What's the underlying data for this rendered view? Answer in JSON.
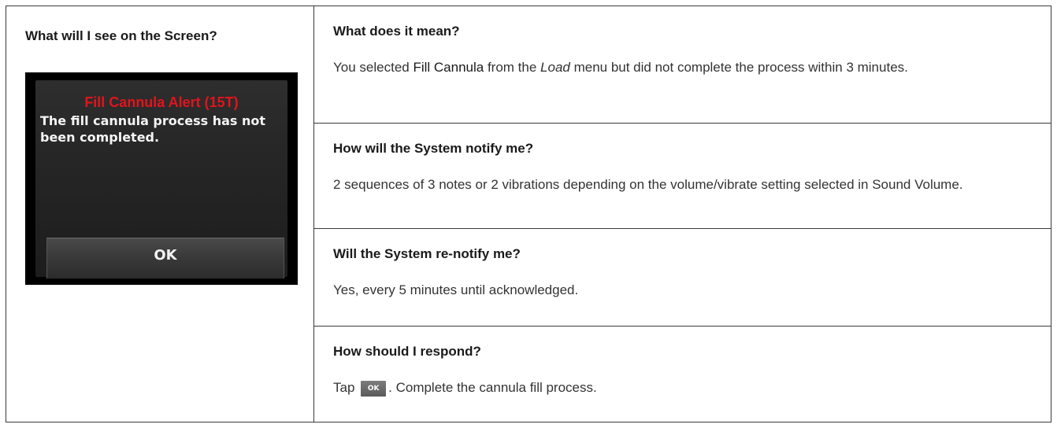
{
  "left": {
    "heading": "What will I see on the Screen?",
    "device": {
      "title": "Fill Cannula Alert (15T)",
      "message": "The fill cannula process has not been completed.",
      "ok_label": "OK"
    }
  },
  "sections": [
    {
      "heading": "What does it mean?",
      "text_part1": "You selected ",
      "text_strong": "Fill Cannula",
      "text_part2": " from the ",
      "text_em": "Load",
      "text_part3": " menu but did not complete the process within 3 minutes."
    },
    {
      "heading": "How will the System notify me?",
      "text": "2 sequences of 3 notes or 2 vibrations depending on the volume/vibrate setting selected in Sound Volume."
    },
    {
      "heading": "Will the System re-notify me?",
      "text": "Yes, every 5 minutes until acknowledged."
    },
    {
      "heading": "How should I respond?",
      "text_before": "Tap ",
      "ok_chip": "OK",
      "text_after": ". Complete the cannula fill process."
    }
  ]
}
